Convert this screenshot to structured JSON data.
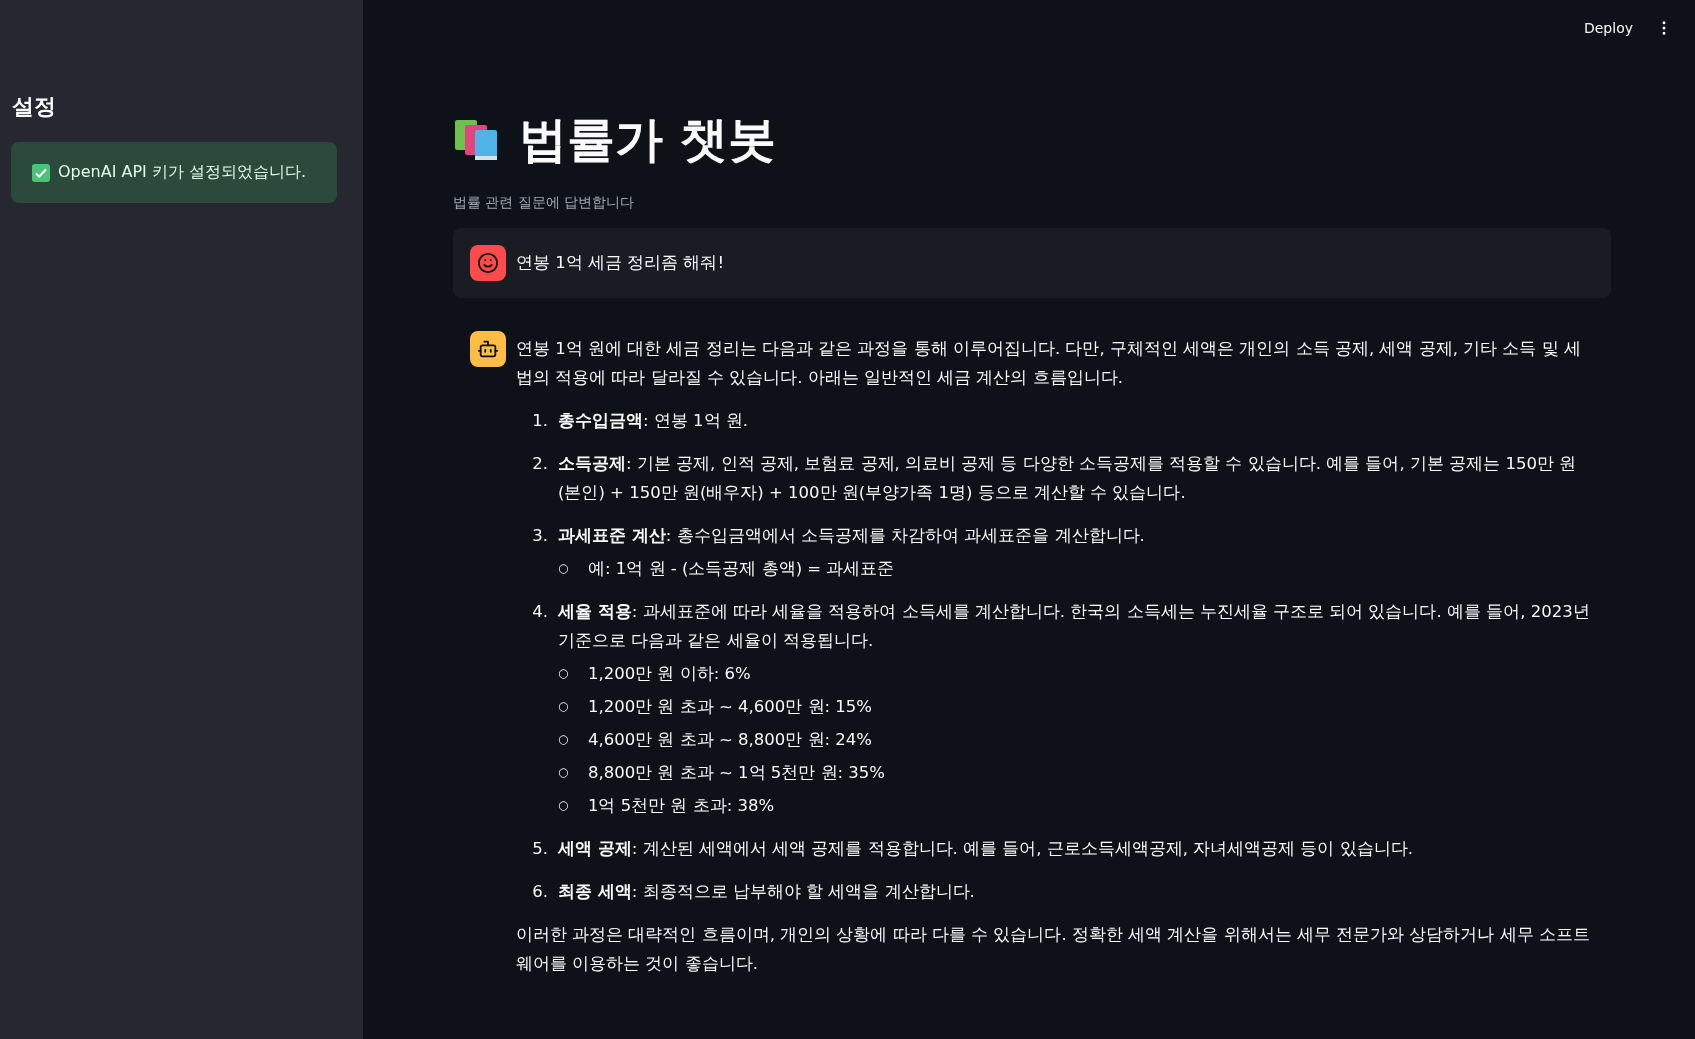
{
  "sidebar": {
    "title": "설정",
    "alert": {
      "kind": "success",
      "text": "OpenAI API 키가 설정되었습니다."
    }
  },
  "header": {
    "deploy": "Deploy"
  },
  "title": "법률가 챗봇",
  "caption": "법률 관련 질문에 답변합니다",
  "messages": [
    {
      "kind": "user",
      "text": "연봉 1억 세금 정리좀 해줘!"
    },
    {
      "kind": "assistant",
      "intro": "연봉 1억 원에 대한 세금 정리는 다음과 같은 과정을 통해 이루어집니다. 다만, 구체적인 세액은 개인의 소득 공제, 세액 공제, 기타 소득 및 세법의 적용에 따라 달라질 수 있습니다. 아래는 일반적인 세금 계산의 흐름입니다.",
      "items": [
        {
          "number": "1.",
          "text": "**총수입금액**: 연봉 1억 원."
        },
        {
          "number": "2.",
          "text": "**소득공제**: 기본 공제, 인적 공제, 보험료 공제, 의료비 공제 등 다양한 소득공제를 적용할 수 있습니다. 예를 들어, 기본 공제는 150만 원(본인) + 150만 원(배우자) + 100만 원(부양가족 1명) 등으로 계산할 수 있습니다."
        },
        {
          "number": "3.",
          "text": "**과세표준 계산**: 총수입금액에서 소득공제를 차감하여 과세표준을 계산합니다.",
          "children": [
            {
              "bullet": "○",
              "text": "예: 1억 원 - (소득공제 총액) = 과세표준"
            }
          ]
        },
        {
          "number": "4.",
          "text": "**세율 적용**: 과세표준에 따라 세율을 적용하여 소득세를 계산합니다. 한국의 소득세는 누진세율 구조로 되어 있습니다. 예를 들어, 2023년 기준으로 다음과 같은 세율이 적용됩니다.",
          "children": [
            {
              "bullet": "○",
              "text": "1,200만 원 이하: 6%"
            },
            {
              "bullet": "○",
              "text": "1,200만 원 초과 ~ 4,600만 원: 15%"
            },
            {
              "bullet": "○",
              "text": "4,600만 원 초과 ~ 8,800만 원: 24%"
            },
            {
              "bullet": "○",
              "text": "8,800만 원 초과 ~ 1억 5천만 원: 35%"
            },
            {
              "bullet": "○",
              "text": "1억 5천만 원 초과: 38%"
            }
          ]
        },
        {
          "number": "5.",
          "text": "**세액 공제**: 계산된 세액에서 세액 공제를 적용합니다. 예를 들어, 근로소득세액공제, 자녀세액공제 등이 있습니다."
        },
        {
          "number": "6.",
          "text": "**최종 세액**: 최종적으로 납부해야 할 세액을 계산합니다."
        }
      ],
      "outro": "이러한 과정은 대략적인 흐름이며, 개인의 상황에 따라 다를 수 있습니다. 정확한 세액 계산을 위해서는 세무 전문가와 상담하거나 세무 소프트웨어를 이용하는 것이 좋습니다."
    }
  ]
}
